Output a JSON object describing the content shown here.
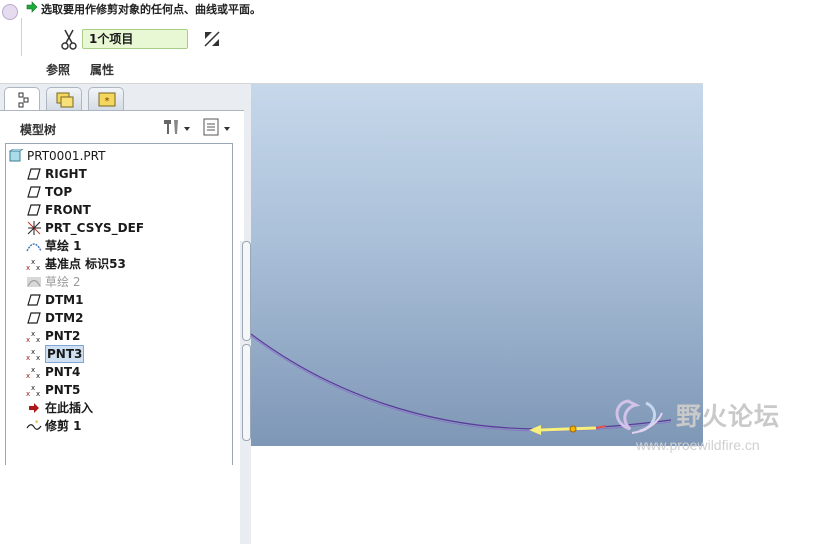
{
  "dashboard": {
    "prompt": "选取要用作修剪对象的任何点、曲线或平面。",
    "collector_value": "1个项目",
    "tabs": [
      "参照",
      "属性"
    ]
  },
  "navigator": {
    "tree_title": "模型树",
    "items": [
      {
        "label": "PRT0001.PRT",
        "icon": "part-icon",
        "state": "normal"
      },
      {
        "label": "RIGHT",
        "icon": "datum-plane-icon",
        "state": "normal"
      },
      {
        "label": "TOP",
        "icon": "datum-plane-icon",
        "state": "normal"
      },
      {
        "label": "FRONT",
        "icon": "datum-plane-icon",
        "state": "normal"
      },
      {
        "label": "PRT_CSYS_DEF",
        "icon": "csys-icon",
        "state": "normal"
      },
      {
        "label": "草绘 1",
        "icon": "sketch-icon",
        "state": "normal"
      },
      {
        "label": "基准点 标识53",
        "icon": "datum-point-icon",
        "state": "normal"
      },
      {
        "label": "草绘 2",
        "icon": "sketch-icon",
        "state": "dim"
      },
      {
        "label": "DTM1",
        "icon": "datum-plane-icon",
        "state": "normal"
      },
      {
        "label": "DTM2",
        "icon": "datum-plane-icon",
        "state": "normal"
      },
      {
        "label": "PNT2",
        "icon": "datum-point-icon",
        "state": "normal"
      },
      {
        "label": "PNT3",
        "icon": "datum-point-icon",
        "state": "selected"
      },
      {
        "label": "PNT4",
        "icon": "datum-point-icon",
        "state": "normal"
      },
      {
        "label": "PNT5",
        "icon": "datum-point-icon",
        "state": "normal"
      },
      {
        "label": "在此插入",
        "icon": "insert-here-icon",
        "state": "normal"
      },
      {
        "label": "修剪 1",
        "icon": "trim-icon",
        "state": "normal"
      }
    ]
  },
  "watermark": {
    "title": "野火论坛",
    "url": "www.proewildfire.cn"
  },
  "colors": {
    "accent_green": "#009a2e",
    "collector_bg": "#e8f7d4",
    "curve": "#6a3fa0",
    "arrow_yellow": "#f7f07a"
  }
}
